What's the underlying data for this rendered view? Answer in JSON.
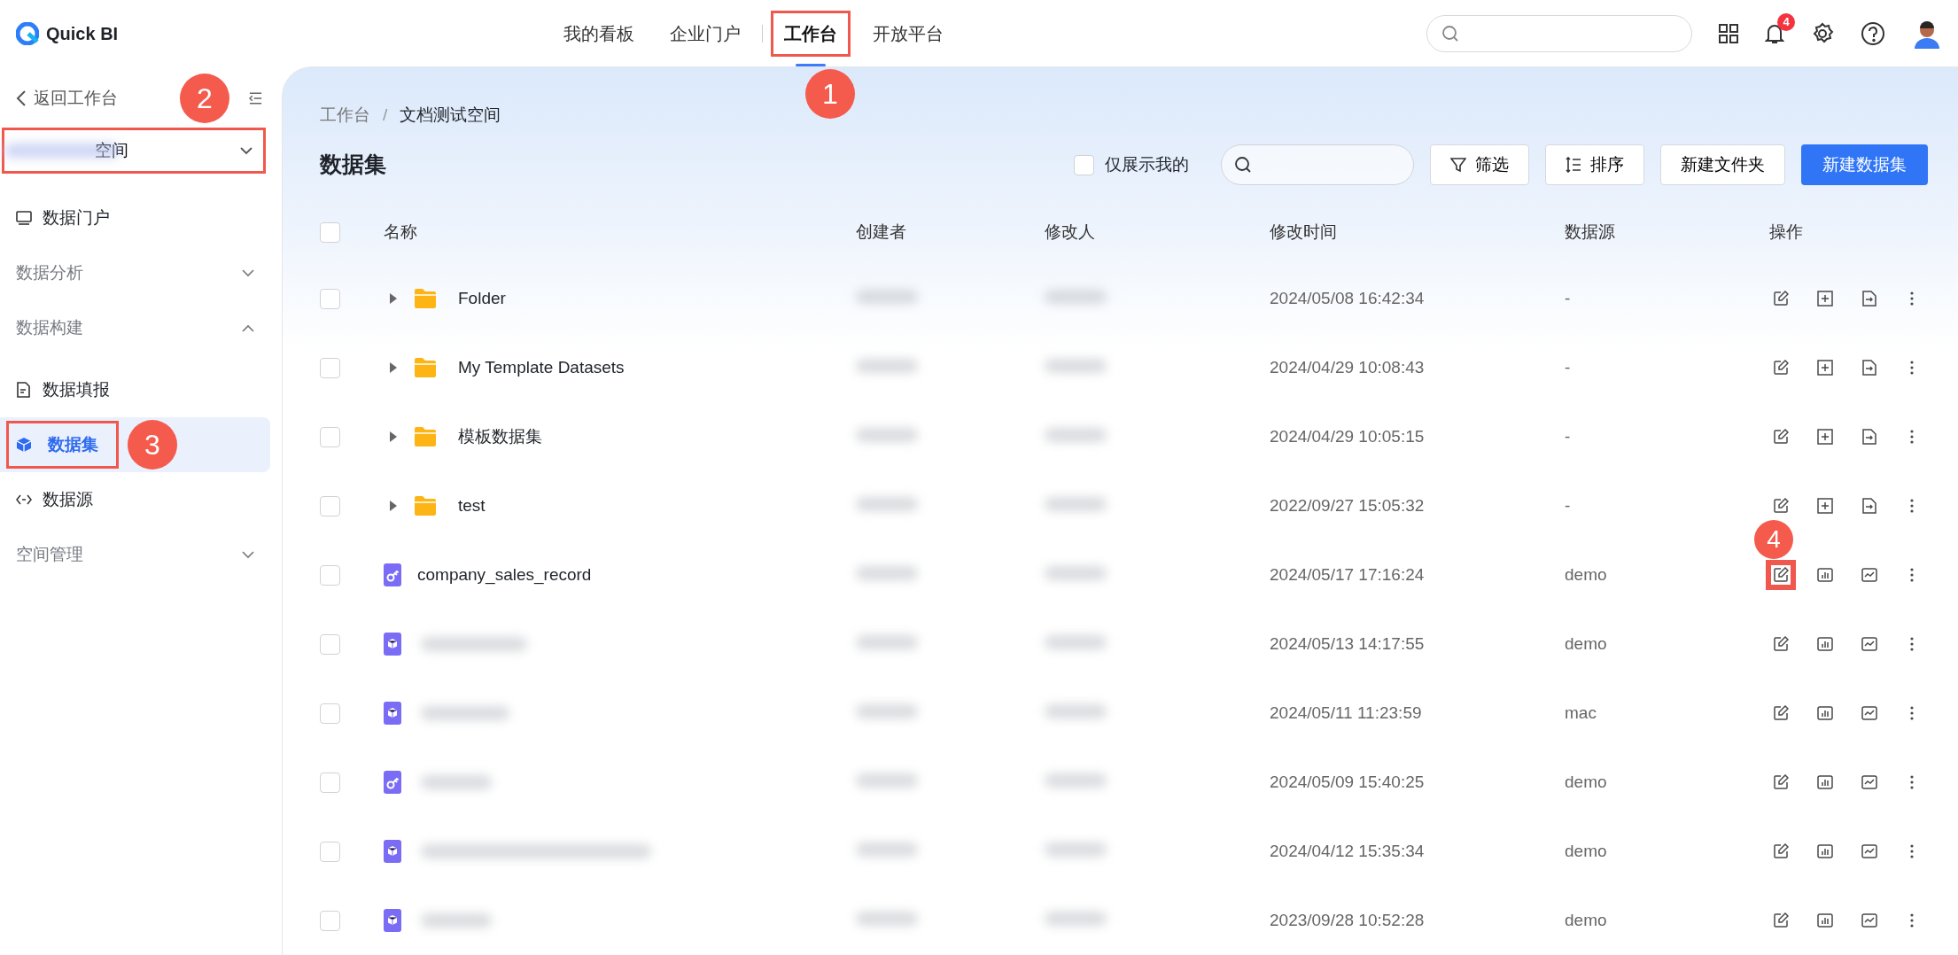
{
  "header": {
    "logo": "Quick BI",
    "nav": [
      {
        "label": "我的看板",
        "selected": false,
        "highlighted": false
      },
      {
        "label": "企业门户",
        "selected": false,
        "highlighted": false
      },
      {
        "label": "工作台",
        "selected": true,
        "highlighted": true
      },
      {
        "label": "开放平台",
        "selected": false,
        "highlighted": false
      }
    ],
    "notifications": "4"
  },
  "sidebar": {
    "back": "返回工作台",
    "space": {
      "label": "空间",
      "highlighted": true
    },
    "items": [
      {
        "kind": "link",
        "label": "数据门户",
        "selected": false,
        "highlighted": false
      },
      {
        "kind": "group",
        "label": "数据分析",
        "expanded": false
      },
      {
        "kind": "group",
        "label": "数据构建",
        "expanded": true
      },
      {
        "kind": "link",
        "label": "数据填报",
        "selected": false,
        "highlighted": false
      },
      {
        "kind": "link",
        "label": "数据集",
        "selected": true,
        "highlighted": true
      },
      {
        "kind": "link",
        "label": "数据源",
        "selected": false,
        "highlighted": false
      },
      {
        "kind": "group",
        "label": "空间管理",
        "expanded": false
      }
    ]
  },
  "breadcrumb": {
    "items": [
      "工作台",
      "文档测试空间"
    ],
    "separator": "/"
  },
  "title": "数据集",
  "toolbar": {
    "only_mine": {
      "label": "仅展示我的",
      "checked": false
    },
    "filter": "筛选",
    "sort": "排序",
    "new_folder": "新建文件夹",
    "new_dataset": "新建数据集"
  },
  "table": {
    "select_all_checked": false,
    "columns": [
      "名称",
      "创建者",
      "修改人",
      "修改时间",
      "数据源",
      "操作"
    ],
    "rows": [
      {
        "kind": "folder",
        "name": "Folder",
        "modified": "2024/05/08 16:42:34",
        "source": "-",
        "checked": false,
        "edit_highlighted": false
      },
      {
        "kind": "folder",
        "name": "My Template Datasets",
        "modified": "2024/04/29 10:08:43",
        "source": "-",
        "checked": false,
        "edit_highlighted": false
      },
      {
        "kind": "folder",
        "name": "模板数据集",
        "modified": "2024/04/29 10:05:15",
        "source": "-",
        "checked": false,
        "edit_highlighted": false
      },
      {
        "kind": "folder",
        "name": "test",
        "modified": "2022/09/27 15:05:32",
        "source": "-",
        "checked": false,
        "edit_highlighted": false
      },
      {
        "kind": "sql",
        "name": "company_sales_record",
        "modified": "2024/05/17 17:16:24",
        "source": "demo",
        "checked": false,
        "edit_highlighted": true
      },
      {
        "kind": "table",
        "modified": "2024/05/13 14:17:55",
        "source": "demo",
        "checked": false,
        "edit_highlighted": false
      },
      {
        "kind": "table",
        "modified": "2024/05/11 11:23:59",
        "source": "mac",
        "checked": false,
        "edit_highlighted": false
      },
      {
        "kind": "sql",
        "modified": "2024/05/09 15:40:25",
        "source": "demo",
        "checked": false,
        "edit_highlighted": false
      },
      {
        "kind": "table",
        "modified": "2024/04/12 15:35:34",
        "source": "demo",
        "checked": false,
        "edit_highlighted": false
      },
      {
        "kind": "table",
        "modified": "2023/09/28 10:52:28",
        "source": "demo",
        "checked": false,
        "edit_highlighted": false
      }
    ]
  },
  "callouts": [
    "1",
    "2",
    "3",
    "4"
  ]
}
